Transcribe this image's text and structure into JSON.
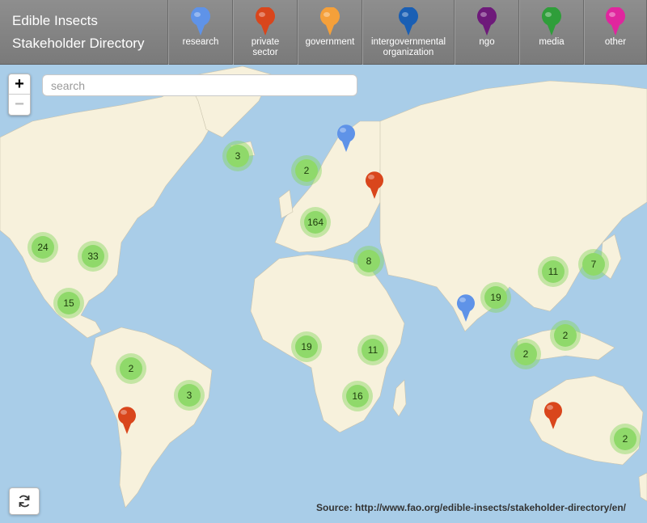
{
  "header": {
    "title_line1": "Edible Insects",
    "title_line2": "Stakeholder Directory",
    "categories": [
      {
        "label": "research",
        "color": "#5f93e8"
      },
      {
        "label": "private\nsector",
        "color": "#d9461c"
      },
      {
        "label": "government",
        "color": "#f5a03a"
      },
      {
        "label": "intergovernmental\norganization",
        "color": "#1a5fb4"
      },
      {
        "label": "ngo",
        "color": "#6e1a7a"
      },
      {
        "label": "media",
        "color": "#2f9e3a"
      },
      {
        "label": "other",
        "color": "#e0269e"
      }
    ]
  },
  "search": {
    "placeholder": "search"
  },
  "zoom": {
    "in": "+",
    "out": "−"
  },
  "clusters": [
    "3",
    "2",
    "164",
    "8",
    "24",
    "33",
    "15",
    "11",
    "7",
    "19",
    "2",
    "2",
    "19",
    "11",
    "2",
    "3",
    "16",
    "2"
  ],
  "markers": [
    "research",
    "private sector",
    "research",
    "private sector",
    "private sector"
  ],
  "source": "Source: http://www.fao.org/edible-insects/stakeholder-directory/en/",
  "colors": {
    "ocean": "#a9cde8",
    "land": "#f7f1dc",
    "cluster": "#8fd96a"
  }
}
